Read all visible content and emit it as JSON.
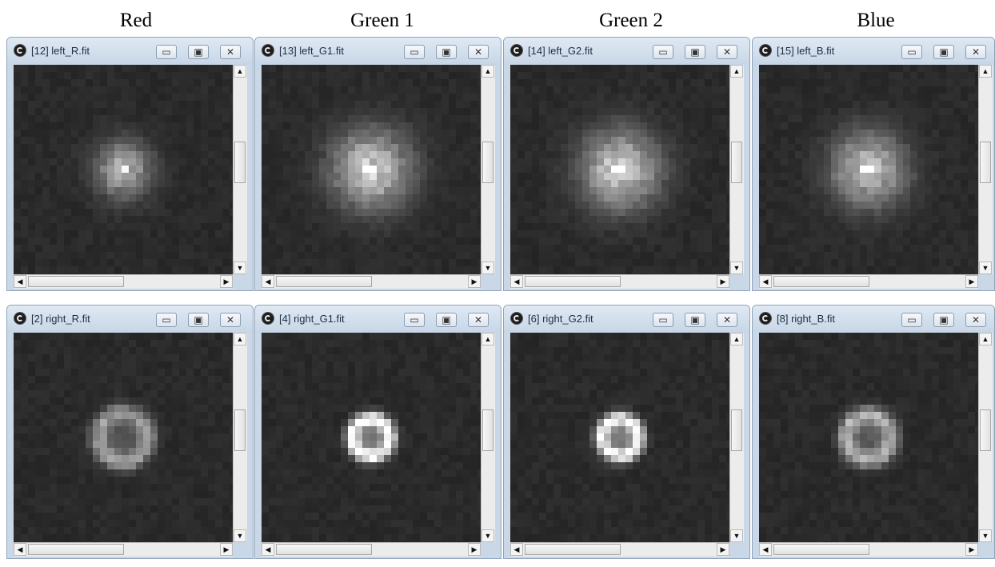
{
  "headings": [
    "Red",
    "Green 1",
    "Green 2",
    "Blue"
  ],
  "windows": [
    {
      "title": "[12] left_R.fit",
      "star": {
        "type": "blob",
        "brightness": 0.55,
        "size": 0.12,
        "peak": 0.8
      }
    },
    {
      "title": "[13] left_G1.fit",
      "star": {
        "type": "blob",
        "brightness": 0.65,
        "size": 0.17,
        "peak": 0.85
      }
    },
    {
      "title": "[14] left_G2.fit",
      "star": {
        "type": "blob",
        "brightness": 0.65,
        "size": 0.17,
        "peak": 0.85
      }
    },
    {
      "title": "[15] left_B.fit",
      "star": {
        "type": "blob",
        "brightness": 0.6,
        "size": 0.16,
        "peak": 1.0
      }
    },
    {
      "title": "[2] right_R.fit",
      "star": {
        "type": "ring",
        "brightness": 0.45,
        "size": 0.13
      }
    },
    {
      "title": "[4] right_G1.fit",
      "star": {
        "type": "ring",
        "brightness": 0.85,
        "size": 0.1
      }
    },
    {
      "title": "[6] right_G2.fit",
      "star": {
        "type": "ring",
        "brightness": 0.85,
        "size": 0.1
      }
    },
    {
      "title": "[8] right_B.fit",
      "star": {
        "type": "ring",
        "brightness": 0.55,
        "size": 0.12
      }
    }
  ],
  "controls": {
    "minimize": "▭",
    "maximize": "▣",
    "close": "✕",
    "scroll_up": "▲",
    "scroll_down": "▼",
    "scroll_left": "◀",
    "scroll_right": "▶"
  },
  "colors": {
    "background": "#282828",
    "titlebar": "#d3dfec"
  }
}
